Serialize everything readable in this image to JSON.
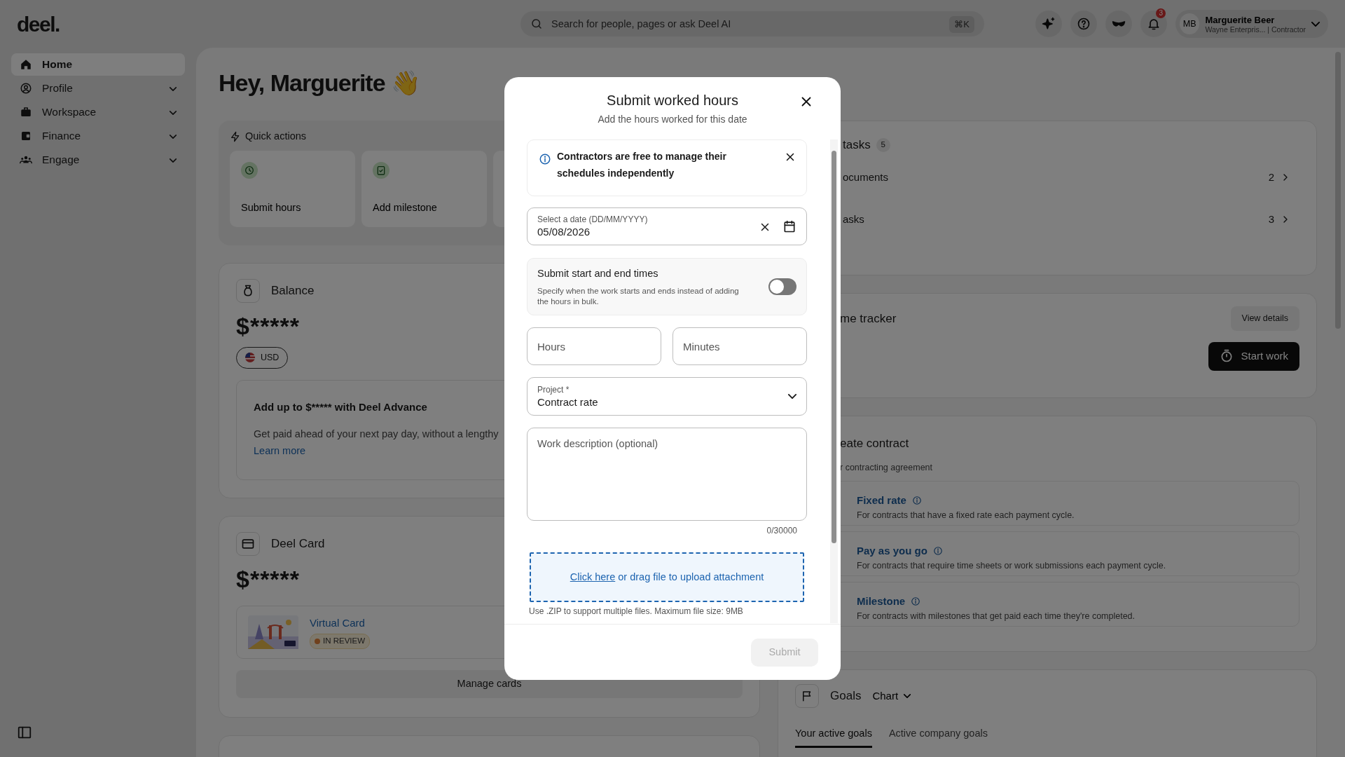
{
  "header": {
    "logo": "deel.",
    "search": {
      "placeholder": "Search for people, pages or ask Deel AI",
      "shortcut": "⌘K"
    },
    "notification_count": "3",
    "user": {
      "initials": "MB",
      "name": "Marguerite Beer",
      "subtitle": "Wayne Enterpris... | Contractor"
    }
  },
  "sidebar": {
    "items": [
      {
        "label": "Home",
        "selected": true,
        "expandable": false
      },
      {
        "label": "Profile",
        "selected": false,
        "expandable": true
      },
      {
        "label": "Workspace",
        "selected": false,
        "expandable": true
      },
      {
        "label": "Finance",
        "selected": false,
        "expandable": true
      },
      {
        "label": "Engage",
        "selected": false,
        "expandable": true
      }
    ]
  },
  "greeting": {
    "text": "Hey, Marguerite",
    "emoji": "👋"
  },
  "quick_actions": {
    "title": "Quick actions",
    "items": [
      {
        "label": "Submit hours"
      },
      {
        "label": "Add milestone"
      }
    ]
  },
  "balance": {
    "title": "Balance",
    "amount": "$*****",
    "currency": "USD",
    "advance": {
      "title": "Add up to $***** with Deel Advance",
      "text": "Get paid ahead of your next pay day, without a lengthy",
      "link": "Learn more"
    }
  },
  "deel_card": {
    "title": "Deel Card",
    "amount": "$*****",
    "card": {
      "name": "Virtual Card",
      "status": "IN REVIEW"
    },
    "button": "Manage cards"
  },
  "tasks": {
    "title": "tasks",
    "count": "5",
    "items": [
      {
        "label": "ocuments",
        "count": "2"
      },
      {
        "label": "asks",
        "count": "3"
      }
    ]
  },
  "time_tracker": {
    "title": "me tracker",
    "details_button": "View details",
    "start_button": "Start work"
  },
  "create_contract": {
    "title": "eate contract",
    "subtitle": "r contracting agreement",
    "options": [
      {
        "title": "Fixed rate",
        "description": "For contracts that have a fixed rate each payment cycle."
      },
      {
        "title": "Pay as you go",
        "description": "For contracts that require time sheets or work submissions each payment cycle."
      },
      {
        "title": "Milestone",
        "description": "For contracts with milestones that get paid each time they're completed."
      }
    ]
  },
  "goals": {
    "title": "Goals",
    "view": "Chart",
    "tabs": [
      {
        "label": "Your active goals",
        "selected": true
      },
      {
        "label": "Active company goals",
        "selected": false
      }
    ]
  },
  "modal": {
    "title": "Submit worked hours",
    "subtitle": "Add the hours worked for this date",
    "alert": "Contractors are free to manage their schedules independently",
    "date": {
      "label": "Select a date (DD/MM/YYYY)",
      "value": "05/08/2026"
    },
    "toggle": {
      "title": "Submit start and end times",
      "description": "Specify when the work starts and ends instead of adding the hours in bulk.",
      "on": false
    },
    "hours": {
      "placeholder": "Hours"
    },
    "minutes": {
      "placeholder": "Minutes"
    },
    "project": {
      "label": "Project *",
      "value": "Contract rate"
    },
    "description": {
      "placeholder": "Work description (optional)",
      "counter": "0/30000"
    },
    "upload": {
      "link": "Click here",
      "text": "or drag file to upload attachment",
      "note": "Use .ZIP to support multiple files. Maximum file size: 9MB"
    },
    "submit": {
      "label": "Submit",
      "disabled": true
    }
  }
}
